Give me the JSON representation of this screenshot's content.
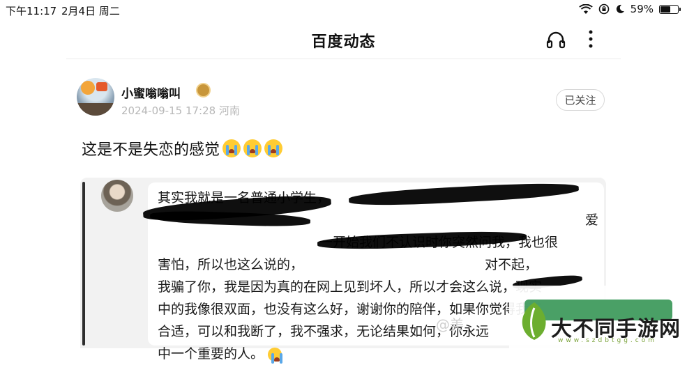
{
  "status_bar": {
    "time": "下午11:17",
    "date": "2月4日 周二",
    "battery": "59%",
    "battery_level": 0.59
  },
  "header": {
    "title": "百度动态",
    "icons": [
      "headphones-icon",
      "more-vertical-icon"
    ]
  },
  "post": {
    "author": "小蜜嗡嗡叫",
    "meta": "2024-09-15 17:28 河南",
    "follow_label": "已关注",
    "text": "这是不是失恋的感觉",
    "emoji": [
      "crying-face",
      "crying-face",
      "crying-face"
    ]
  },
  "embedded_chat": {
    "lines": [
      "其实我就是一名普通小学生，",
      "",
      "一开始我们不认识时你突然问我，我也很",
      "害怕，所以也这么说的，",
      "我骗了你，我是因为真的在网上见到坏人，所以才会这么说，现实",
      "中的我像很双面，也没有这么好，谢谢你的陪伴，如果你觉得我不",
      "合适，可以和我断了，我不强求，无论结果如何，你永远",
      "中一个重要的人。"
    ],
    "line2_tail": "爱",
    "line4_tail": "对不起，"
  },
  "watermark": "@美",
  "logo": {
    "text": "大不同手游网",
    "sub": "www.szdbtgg.com"
  },
  "colors": {
    "logo_green": "#2a8f4b",
    "leaf_green": "#6cae2f",
    "emoji_yellow": "#ffcc33"
  }
}
